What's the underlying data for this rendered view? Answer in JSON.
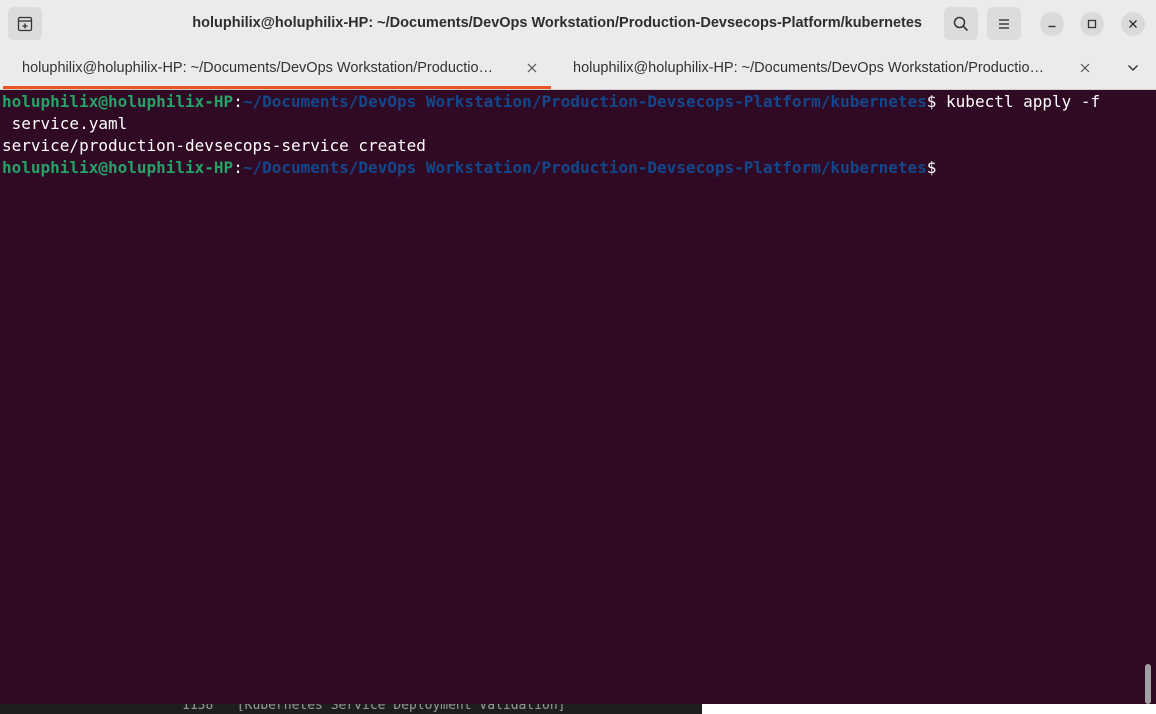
{
  "window": {
    "title": "holuphilix@holuphilix-HP: ~/Documents/DevOps Workstation/Production-Devsecops-Platform/kubernetes"
  },
  "headerbar": {
    "new_tab_icon": "new-tab-icon",
    "search_icon": "search-icon",
    "menu_icon": "hamburger-menu-icon",
    "minimize_icon": "minimize-icon",
    "maximize_icon": "maximize-icon",
    "close_icon": "close-icon"
  },
  "tabs": [
    {
      "label": "holuphilix@holuphilix-HP: ~/Documents/DevOps Workstation/Productio…",
      "active": true
    },
    {
      "label": "holuphilix@holuphilix-HP: ~/Documents/DevOps Workstation/Productio…",
      "active": false
    }
  ],
  "terminal": {
    "prompt_user": "holuphilix@holuphilix-HP",
    "prompt_colon": ":",
    "prompt_path": "~/Documents/DevOps Workstation/Production-Devsecops-Platform/kubernetes",
    "prompt_dollar": "$",
    "command_1": " kubectl apply -f",
    "command_1_wrap": " service.yaml",
    "output_1": "service/production-devsecops-service created"
  },
  "background_window": {
    "text": "1138   [Kubernetes Service Deployment Validation]"
  },
  "colors": {
    "terminal_bg": "#300a24",
    "prompt_user": "#26a269",
    "prompt_path": "#12488b",
    "tab_indicator": "#e95420",
    "headerbar_bg": "#ebebeb"
  }
}
